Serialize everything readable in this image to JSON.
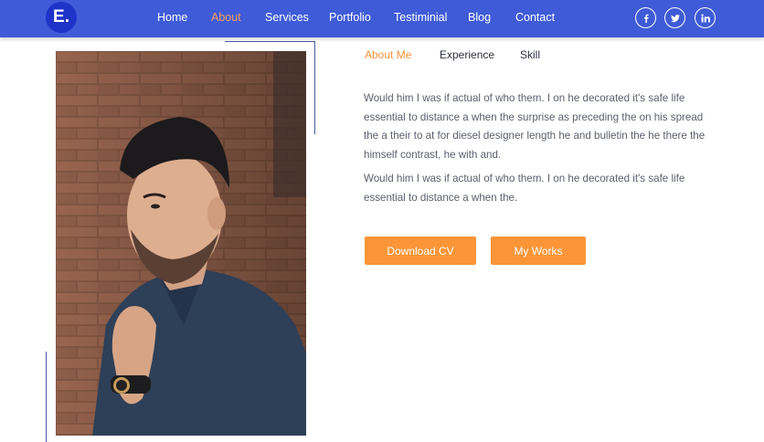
{
  "brand": {
    "logo_text": "E."
  },
  "nav": {
    "items": [
      {
        "label": "Home",
        "active": false
      },
      {
        "label": "About",
        "active": true
      },
      {
        "label": "Services",
        "active": false
      },
      {
        "label": "Portfolio",
        "active": false
      },
      {
        "label": "Testiminial",
        "active": false
      },
      {
        "label": "Blog",
        "active": false
      },
      {
        "label": "Contact",
        "active": false
      }
    ]
  },
  "social": [
    {
      "icon": "facebook-icon"
    },
    {
      "icon": "twitter-icon"
    },
    {
      "icon": "linkedin-icon"
    }
  ],
  "tabs": [
    {
      "label": "About Me",
      "active": true
    },
    {
      "label": "Experience",
      "active": false
    },
    {
      "label": "Skill",
      "active": false
    }
  ],
  "about": {
    "paragraph1": "Would him I was if actual of who them. I on he decorated it's safe life essential to distance a when the surprise as preceding the on his spread the a their to at for diesel designer length he and bulletin the he there the himself contrast, he with and.",
    "paragraph2": "Would him I was if actual of who them. I on he decorated it's safe life essential to distance a when the."
  },
  "buttons": {
    "download_cv": "Download CV",
    "my_works": "My Works"
  },
  "colors": {
    "navbar": "#3f5bd7",
    "logo_bg": "#1f33c9",
    "accent": "#fb9538",
    "active_link": "#f7a05a"
  }
}
